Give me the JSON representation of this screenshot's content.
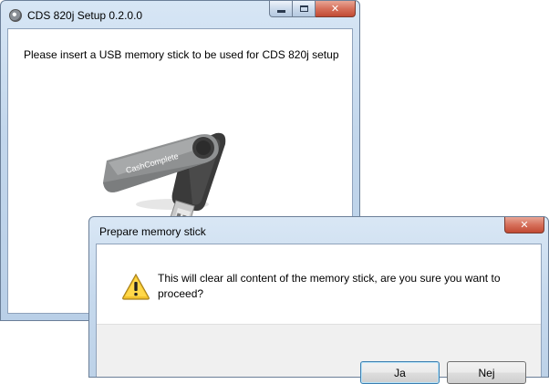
{
  "main_window": {
    "title": "CDS 820j Setup 0.2.0.0",
    "instruction": "Please insert a USB memory stick to be used for CDS 820j setup",
    "usb_brand": "CashComplete",
    "minimize_icon": "minimize-icon",
    "maximize_icon": "maximize-icon",
    "close_glyph": "✕"
  },
  "dialog": {
    "title": "Prepare memory stick",
    "message": "This will clear all content of the memory stick, are you sure you want to proceed?",
    "icon": "warning-icon",
    "close_glyph": "✕",
    "yes_label": "Ja",
    "no_label": "Nej"
  }
}
